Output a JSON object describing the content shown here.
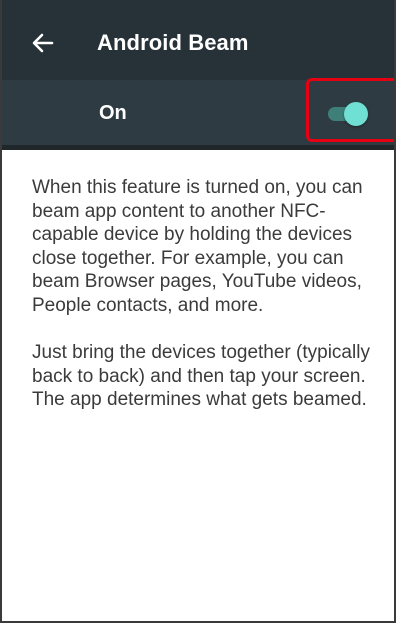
{
  "header": {
    "title": "Android Beam",
    "back_icon": "arrow-left-icon"
  },
  "toggle_row": {
    "label": "On",
    "state": "on",
    "toggle_icon": "toggle-switch-on-icon",
    "accent_color": "#6fe0d3"
  },
  "highlight": {
    "color": "#e60012"
  },
  "description": {
    "paragraph1": "When this feature is turned on, you can beam app content to another NFC-capable device by holding the devices close together. For example, you can beam Browser pages, YouTube videos, People contacts, and more.",
    "paragraph2": "Just bring the devices together (typically back to back) and then tap your screen. The app determines what gets beamed."
  }
}
